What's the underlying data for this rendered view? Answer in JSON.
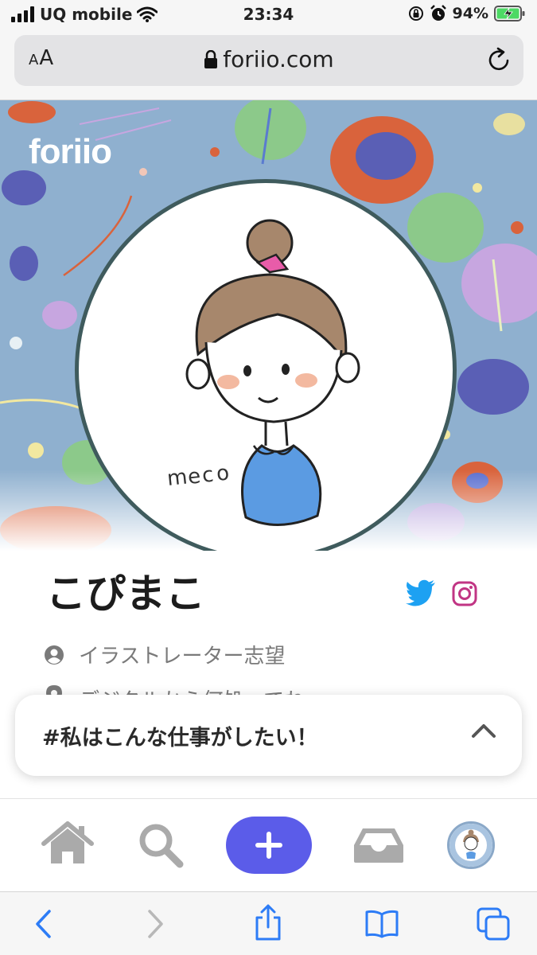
{
  "status_bar": {
    "carrier": "UQ mobile",
    "time": "23:34",
    "battery": "94%"
  },
  "browser": {
    "aa_label_small": "A",
    "aa_label_large": "A",
    "url": "foriio.com"
  },
  "site": {
    "brand": "foriio"
  },
  "profile": {
    "name": "こぴまこ",
    "role": "イラストレーター志望",
    "location": "デジタルから何処ってね"
  },
  "card": {
    "title": "#私はこんな仕事がしたい！"
  },
  "colors": {
    "accent": "#5b5ce9",
    "twitter": "#1da1f2",
    "instagram": "#c13584",
    "hero_bg": "#8fb0cf",
    "avatar_ring": "#3f5b5d"
  }
}
